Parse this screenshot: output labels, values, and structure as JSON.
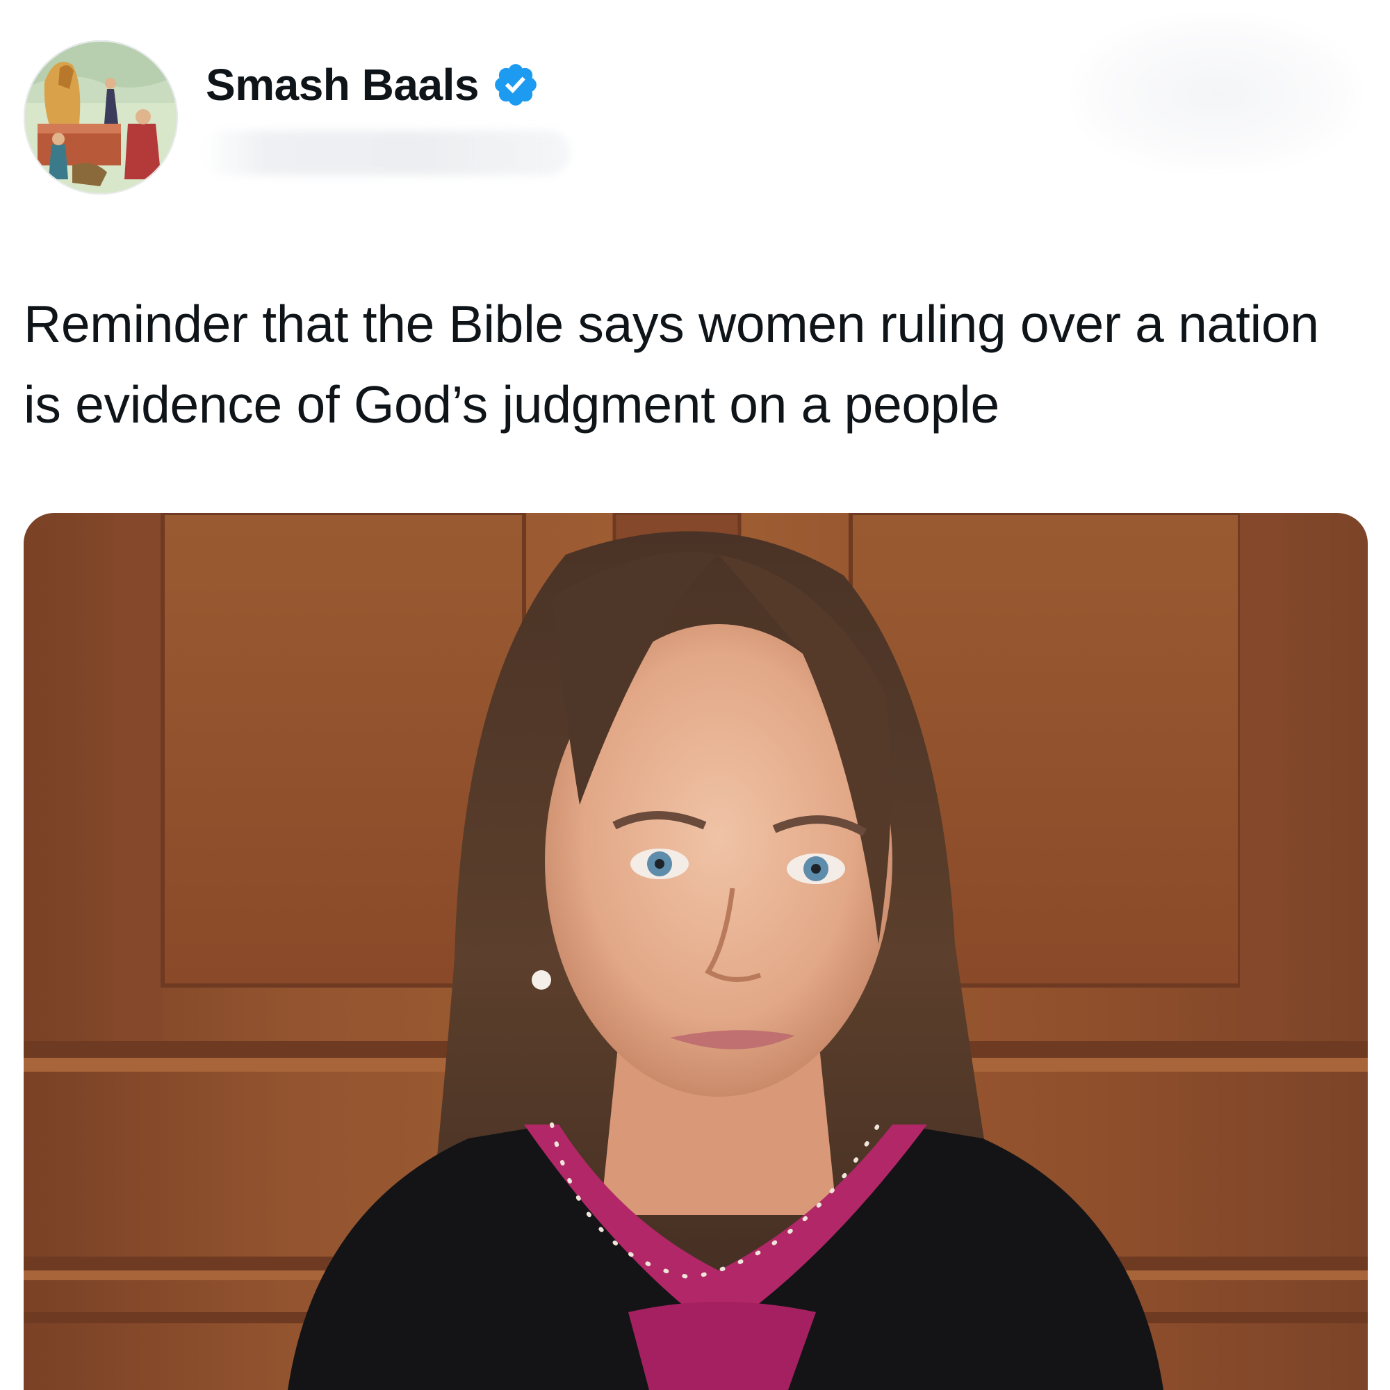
{
  "tweet": {
    "author": {
      "display_name": "Smash Baals",
      "verified": true,
      "verified_color": "#1d9bf0"
    },
    "text": "Reminder that the Bible says women ruling over a nation is evidence of God’s judgment on a people",
    "media": {
      "type": "photo"
    }
  },
  "colors": {
    "text": "#0f1419",
    "background": "#ffffff",
    "accent": "#1d9bf0"
  },
  "icons": {
    "verified": "verified-badge-icon"
  }
}
